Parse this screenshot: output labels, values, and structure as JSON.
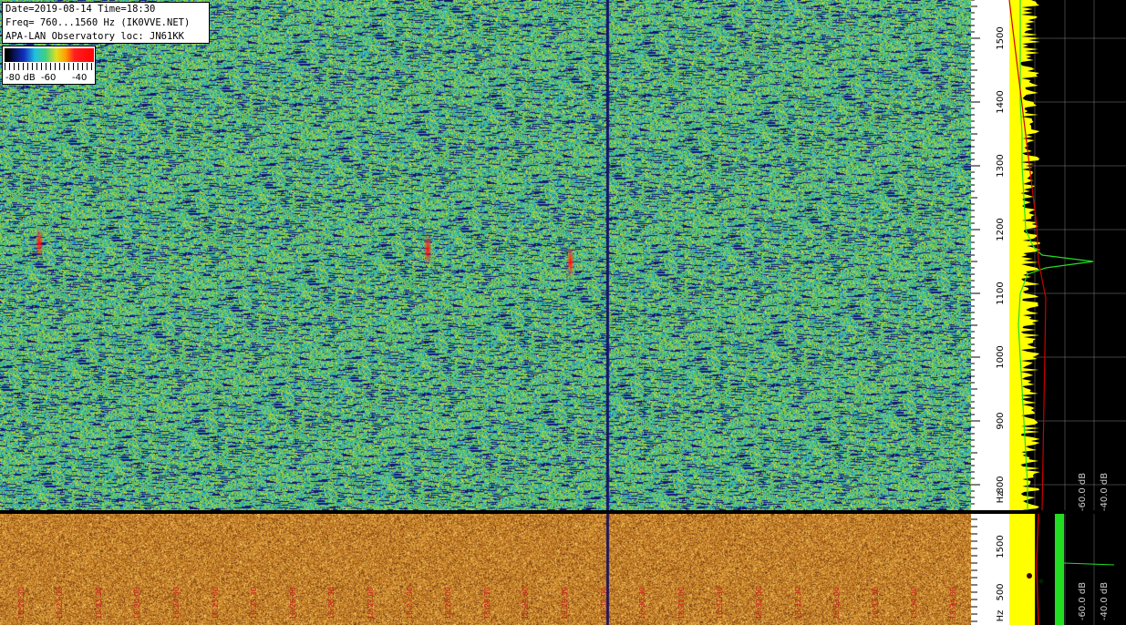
{
  "header": {
    "line1": "Date=2019-08-14 Time=18:30",
    "line2": "Freq= 760...1560 Hz (IK0VVE.NET)",
    "line3": "APA-LAN Observatory loc: JN61KK"
  },
  "color_scale": {
    "label_min": "-80 dB",
    "label_mid": "-60",
    "label_max": "-40"
  },
  "colors": {
    "waterfall_base": "#3cb878",
    "lower_base": "#c88a2c",
    "spectrum_fill": "#ffff00",
    "avg_line": "#cc0000",
    "green_trace": "#22dd22",
    "label_red": "#cc2020"
  },
  "chart_data": [
    {
      "type": "heatmap",
      "title": "",
      "ylabel": "Hz",
      "ylim": [
        760,
        1560
      ],
      "yticks": [
        "800",
        "900",
        "1000",
        "1100",
        "1200",
        "1300",
        "1400",
        "1500"
      ],
      "unit_label": "Hz",
      "events": [
        {
          "x_frac": 0.04,
          "freq": 1180,
          "intensity": "red"
        },
        {
          "x_frac": 0.44,
          "freq": 1170,
          "intensity": "red"
        },
        {
          "x_frac": 0.587,
          "freq": 1150,
          "intensity": "red"
        }
      ],
      "carrier_x_frac": 0.625
    },
    {
      "type": "heatmap",
      "ylabel": "Hz",
      "yticks": [
        "500",
        "1500"
      ],
      "unit_label": "Hz",
      "time_labels": [
        "18:22:30",
        "18:23:00",
        "18:23:30",
        "18:24:00",
        "18:24:30",
        "18:25:00",
        "18:25:30",
        "18:26:00",
        "18:26:30",
        "18:27:00",
        "18:27:30",
        "18:28:00",
        "18:28:30",
        "18:29:00",
        "18:29:30",
        "18:30:00",
        "18:30:30",
        "18:31:00",
        "18:31:30",
        "18:32:00",
        "18:32:30",
        "18:33:00",
        "18:33:30",
        "18:34:00",
        "18:34:30"
      ]
    },
    {
      "type": "line",
      "xlabel": "dB",
      "x_ticks": [
        "-60.0 dB",
        "-40.0 dB"
      ],
      "peak_freq": 1150,
      "series": [
        {
          "values": [
            [
              760,
              -62
            ],
            [
              800,
              -62
            ],
            [
              850,
              -62.5
            ],
            [
              900,
              -63
            ],
            [
              950,
              -63.5
            ],
            [
              1000,
              -64
            ],
            [
              1050,
              -64.5
            ],
            [
              1100,
              -64
            ],
            [
              1130,
              -62
            ],
            [
              1140,
              -57
            ],
            [
              1150,
              -44
            ],
            [
              1160,
              -58
            ],
            [
              1170,
              -60
            ],
            [
              1180,
              -61
            ],
            [
              1200,
              -62.5
            ],
            [
              1250,
              -63
            ],
            [
              1300,
              -63.5
            ],
            [
              1350,
              -63.5
            ],
            [
              1400,
              -64
            ],
            [
              1450,
              -64
            ],
            [
              1500,
              -64
            ],
            [
              1560,
              -64
            ]
          ]
        }
      ]
    },
    {
      "type": "line",
      "x_ticks": [
        "-60.0 dB",
        "-40.0 dB"
      ]
    }
  ]
}
